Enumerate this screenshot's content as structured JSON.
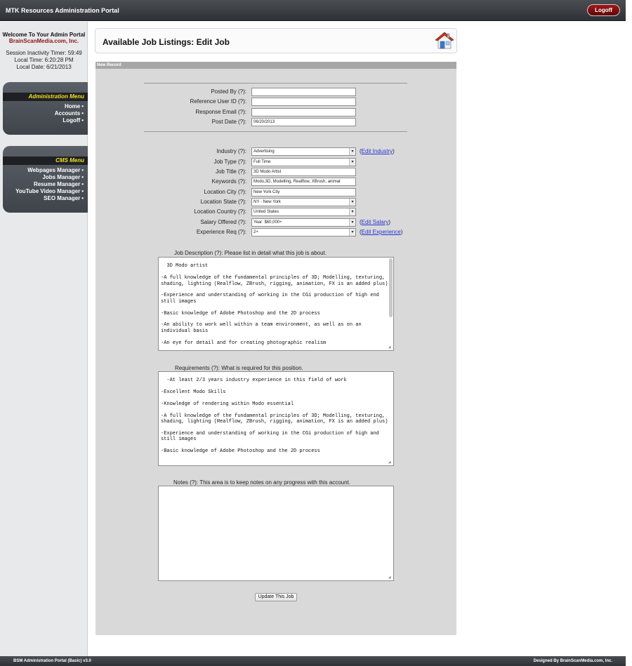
{
  "app": {
    "title": "MTK Resources Administration Portal",
    "logoff_label": "Logoff"
  },
  "sidebar": {
    "welcome": "Welcome To Your Admin Portal",
    "company": "BrainScanMedia.com, Inc.",
    "session_timer": "Session Inactivity Timer: 59:49",
    "local_time": "Local Time: 6:20:28 PM",
    "local_date": "Local Date: 6/21/2013",
    "admin_menu": {
      "title": "Administration Menu",
      "items": [
        "Home",
        "Accounts",
        "Logoff"
      ]
    },
    "cms_menu": {
      "title": "CMS Menu",
      "items": [
        "Webpages Manager",
        "Jobs Manager",
        "Resume Manager",
        "YouTube Video Manager",
        "SEO Manager"
      ]
    },
    "bullet": "•"
  },
  "page": {
    "title": "Available Job Listings: Edit Job",
    "home_icon": "home-icon",
    "section_label": "New Record"
  },
  "form": {
    "posted_by": {
      "label": "Posted By (?):",
      "value": ""
    },
    "reference_user_id": {
      "label": "Reference User ID (?):",
      "value": ""
    },
    "response_email": {
      "label": "Response Email (?):",
      "value": ""
    },
    "post_date": {
      "label": "Post Date (?):",
      "value": "06/20/2013"
    },
    "industry": {
      "label": "Industry (?):",
      "value": "Advertising",
      "edit_link": "Edit Industry"
    },
    "job_type": {
      "label": "Job Type (?):",
      "value": "Full Time"
    },
    "job_title": {
      "label": "Job Title (?):",
      "value": "3D Modo Artist"
    },
    "keywords": {
      "label": "Keywords (?):",
      "value": "Modo,3D, Modelling, Realflow, XBrush, animat"
    },
    "location_city": {
      "label": "Location City (?):",
      "value": "New York City"
    },
    "location_state": {
      "label": "Location State (?):",
      "value": "NY - New York"
    },
    "location_country": {
      "label": "Location Country (?):",
      "value": "United States"
    },
    "salary_offered": {
      "label": "Salary Offered (?):",
      "value": "Year: $60,000+",
      "edit_link": "Edit Salary"
    },
    "experience_req": {
      "label": "Experience Req (?):",
      "value": "2+",
      "edit_link": "Edit Experience"
    },
    "edit_open": "(",
    "edit_close": ")",
    "job_description": {
      "label": "Job Description (?): Please list in detail what this job is about.",
      "value": "3D Modo artist\n\n-A full knowledge of the fundamental principles of 3D; Modelling, texturing, shading, lighting (Realflow, ZBrush, rigging, animation, FX is an added plus)\n\n-Experience and understanding of working in the CGi production of high end still images\n\n-Basic knowledge of Adobe Photoshop and the 2D process\n\n-An ability to work well within a team environment, as well as on an individual basis\n\n-An eye for detail and for creating photographic realism"
    },
    "requirements": {
      "label": "Requirements (?): What is required for this position.",
      "value": "-At least 2/3 years industry experience in this field of work\n\n-Excellent Modo Skills\n\n-Knowledge of rendering within Modo essential\n\n-A full knowledge of the fundamental principles of 3D; Modelling, texturing, shading, lighting (Realflow, ZBrush, rigging, animation, FX is an added plus)\n\n-Experience and understanding of working in the CGi production of high and still images\n\n-Basic knowledge of Adobe Photoshop and the 2D process"
    },
    "notes": {
      "label": "Notes (?): This area is to keep notes on any progress with this account.",
      "value": ""
    },
    "submit_label": "Update This Job"
  },
  "footer": {
    "left": "BSM Administration Portal (Basic) v3.0",
    "right": "Designed By BrainScanMedia.com, Inc."
  },
  "colors": {
    "accent_menu_title": "#f2e21c",
    "logoff_red": "#8b0e0e",
    "company_red": "#8a1414",
    "link_blue": "#2a33d6",
    "panel_gray": "#d9d9d9"
  }
}
